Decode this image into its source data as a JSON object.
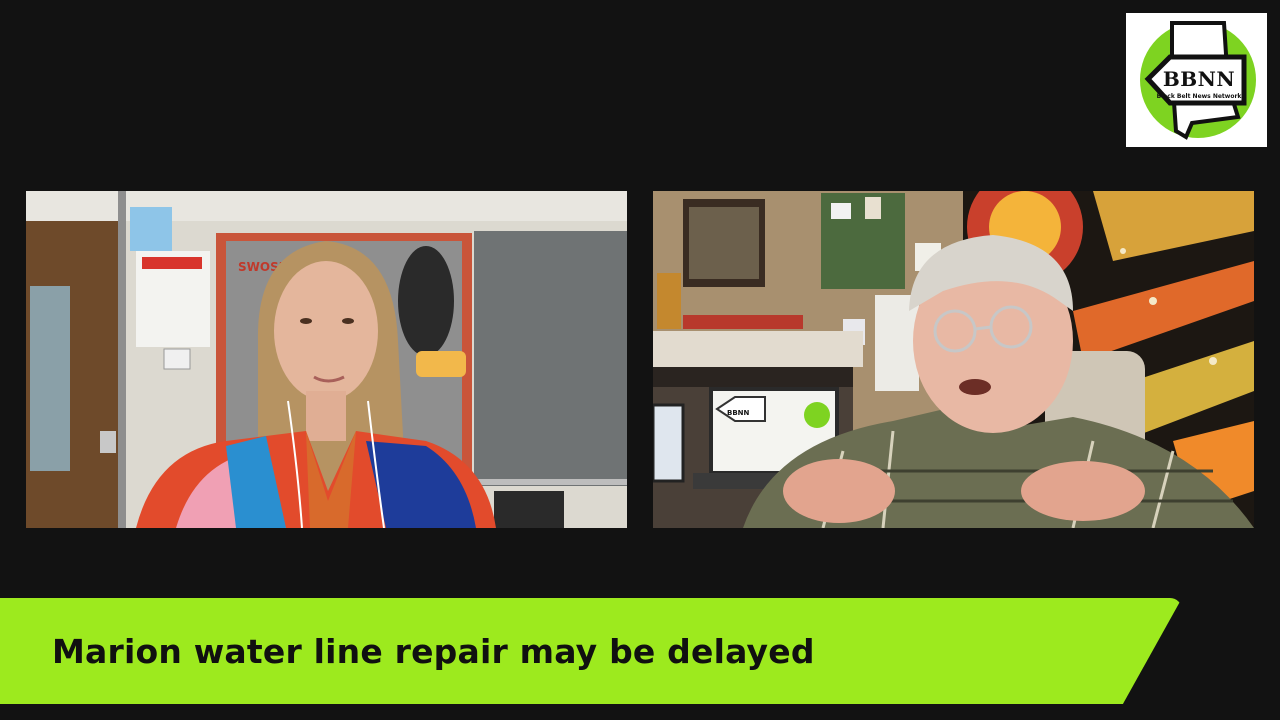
{
  "logo": {
    "name": "BBNN",
    "subtitle": "Black Belt News Network",
    "accent_color": "#7ed321"
  },
  "tiles": [
    {
      "id": "guest-left",
      "label": "video-feed-guest"
    },
    {
      "id": "host-right",
      "label": "video-feed-host"
    }
  ],
  "background_labels": {
    "swosh": "SWOSH",
    "laptop_logo": "BBNN"
  },
  "lower_third": {
    "headline": "Marion water line repair may be delayed",
    "color": "#9dea1e"
  }
}
